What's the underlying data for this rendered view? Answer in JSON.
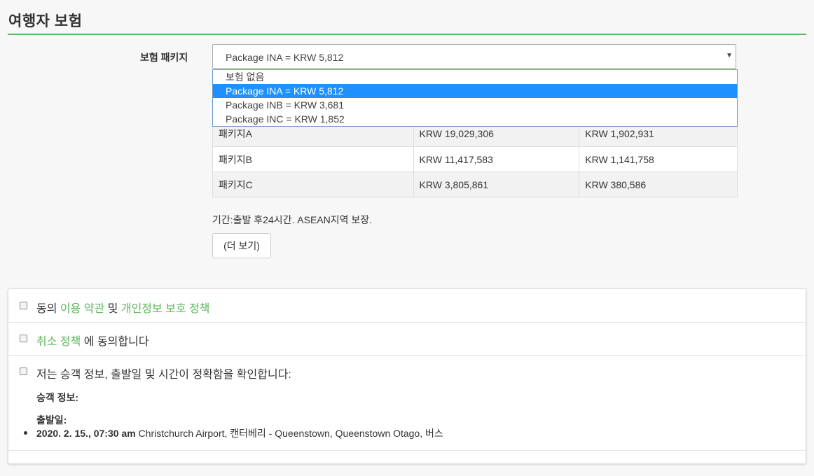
{
  "page": {
    "title": "여행자 보험"
  },
  "insurance": {
    "label": "보험 패키지",
    "selected": "Package INA = KRW 5,812",
    "options": [
      "보험 없음",
      "Package INA = KRW 5,812",
      "Package INB = KRW 3,681",
      "Package INC = KRW 1,852"
    ],
    "table": [
      [
        "패키지A",
        "KRW 19,029,306",
        "KRW 1,902,931"
      ],
      [
        "패키지B",
        "KRW 11,417,583",
        "KRW 1,141,758"
      ],
      [
        "패키지C",
        "KRW 3,805,861",
        "KRW 380,586"
      ]
    ],
    "note": "기간:출발 후24시간. ASEAN지역 보장.",
    "more_button": "(더 보기)"
  },
  "agreements": {
    "terms": {
      "prefix": "동의 ",
      "link1": "이용 약관",
      "mid": " 및 ",
      "link2": "개인정보 보호 정책"
    },
    "cancel": {
      "link": "취소 정책",
      "suffix": " 에 동의합니다"
    },
    "confirm": {
      "text": "저는 승객 정보, 출발일 및 시간이 정확함을 확인합니다:",
      "passenger_label": "승객 정보:",
      "departure_label": "출발일:",
      "trip_datetime": "2020. 2. 15., 07:30 am",
      "trip_route": " Christchurch Airport, 캔터베리 - Queenstown, Queenstown Otago, 버스"
    }
  }
}
